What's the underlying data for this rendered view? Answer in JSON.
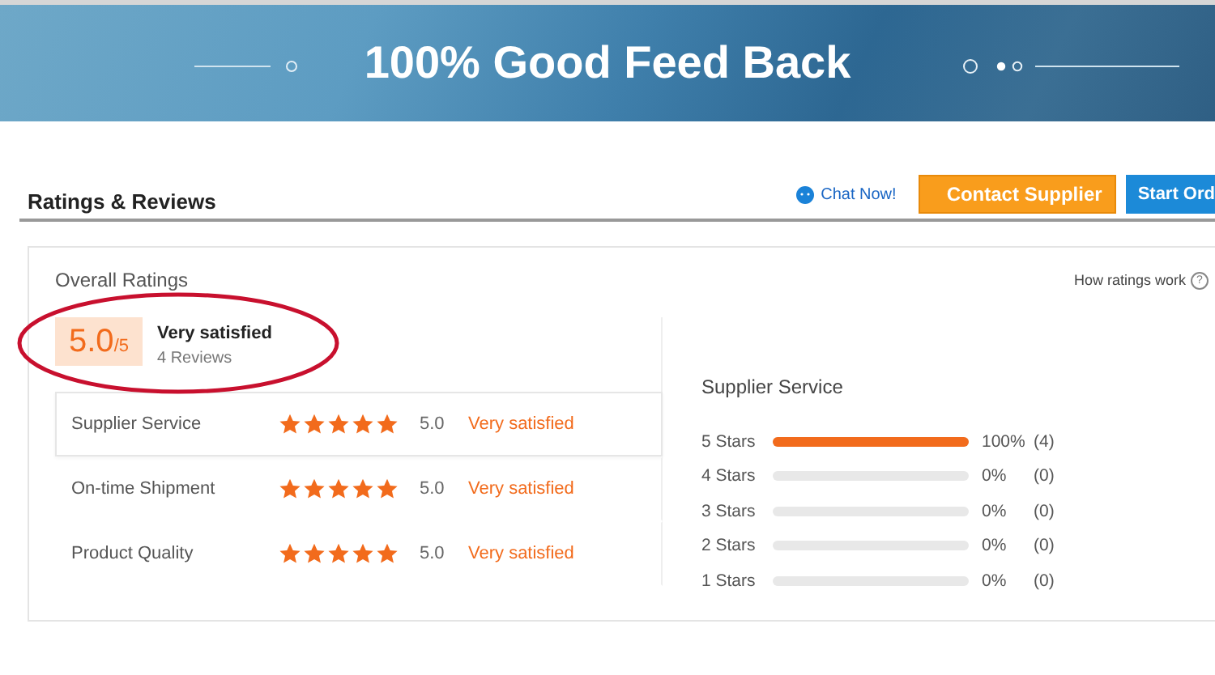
{
  "banner": {
    "title": "100% Good Feed Back"
  },
  "header": {
    "title": "Ratings & Reviews",
    "chat_link": "Chat Now!",
    "buttons": [
      {
        "label": "Contact Supplier",
        "kind": "contact"
      },
      {
        "label": "Start Ord",
        "kind": "order"
      }
    ]
  },
  "overall": {
    "title": "Overall Ratings",
    "help_link": "How ratings work",
    "help_icon": "?",
    "score": "5.0",
    "score_max": "/5",
    "verdict": "Very satisfied",
    "reviews": "4 Reviews"
  },
  "categories": [
    {
      "name": "Supplier Service",
      "stars": 5,
      "value": "5.0",
      "verdict": "Very satisfied",
      "selected": true
    },
    {
      "name": "On-time Shipment",
      "stars": 5,
      "value": "5.0",
      "verdict": "Very satisfied",
      "selected": false
    },
    {
      "name": "Product Quality",
      "stars": 5,
      "value": "5.0",
      "verdict": "Very satisfied",
      "selected": false
    }
  ],
  "distribution": {
    "title": "Supplier Service",
    "rows": [
      {
        "label": "5 Stars",
        "level": 1,
        "percent": "100%",
        "count": "(4)"
      },
      {
        "label": "4 Stars",
        "level": 0,
        "percent": "0%",
        "count": "(0)"
      },
      {
        "label": "3 Stars",
        "level": 0,
        "percent": "0%",
        "count": "(0)"
      },
      {
        "label": "2 Stars",
        "level": 0,
        "percent": "0%",
        "count": "(0)"
      },
      {
        "label": "1 Stars",
        "level": 0,
        "percent": "0%",
        "count": "(0)"
      }
    ]
  }
}
